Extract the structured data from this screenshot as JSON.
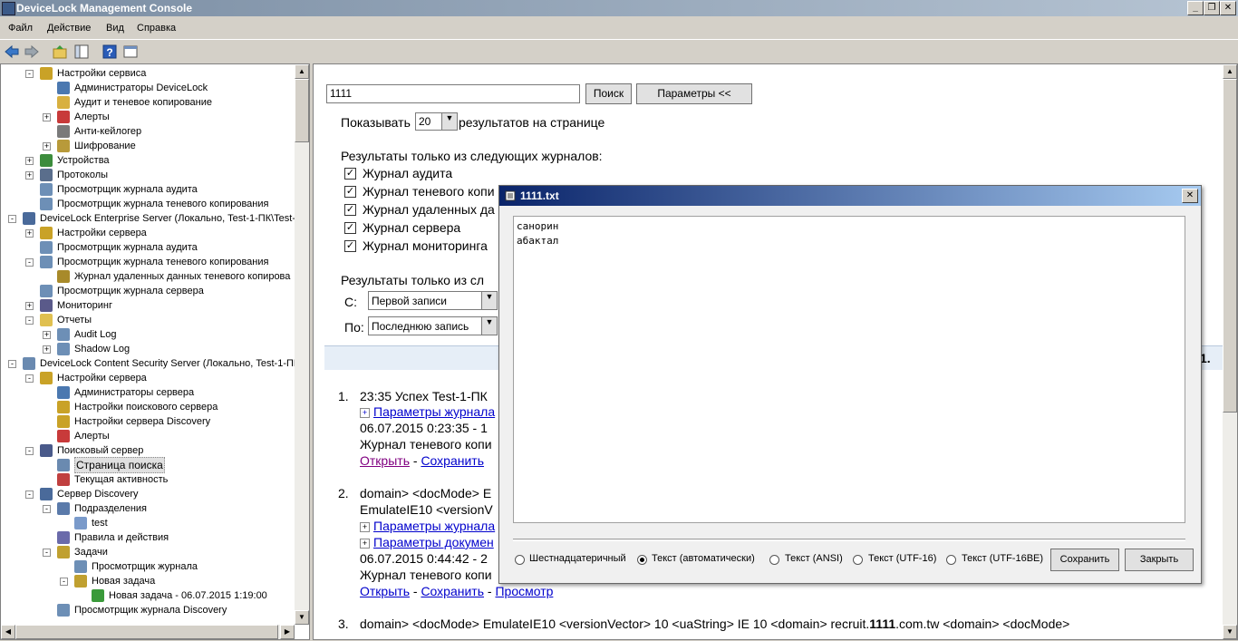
{
  "window": {
    "title": "DeviceLock Management Console"
  },
  "menu": [
    "Файл",
    "Действие",
    "Вид",
    "Справка"
  ],
  "toolbar_icons": [
    "back-arrow-icon",
    "forward-arrow-icon",
    "folder-up-icon",
    "show-tree-icon",
    "help-icon",
    "properties-icon"
  ],
  "tree": [
    {
      "label": "Настройки сервиса",
      "level": 2,
      "exp": "-",
      "icon": "gear"
    },
    {
      "label": "Администраторы DeviceLock",
      "level": 3,
      "exp": "",
      "icon": "users"
    },
    {
      "label": "Аудит и теневое копирование",
      "level": 3,
      "exp": "",
      "icon": "doc"
    },
    {
      "label": "Алерты",
      "level": 3,
      "exp": "+",
      "icon": "alert"
    },
    {
      "label": "Анти-кейлогер",
      "level": 3,
      "exp": "",
      "icon": "keyboard"
    },
    {
      "label": "Шифрование",
      "level": 3,
      "exp": "+",
      "icon": "crypt"
    },
    {
      "label": "Устройства",
      "level": 2,
      "exp": "+",
      "icon": "chip"
    },
    {
      "label": "Протоколы",
      "level": 2,
      "exp": "+",
      "icon": "proto"
    },
    {
      "label": "Просмотрщик журнала аудита",
      "level": 2,
      "exp": "",
      "icon": "log"
    },
    {
      "label": "Просмотрщик журнала теневого копирования",
      "level": 2,
      "exp": "",
      "icon": "log"
    },
    {
      "label": "DeviceLock Enterprise Server (Локально, Test-1-ПК\\Test-",
      "level": 1,
      "exp": "-",
      "icon": "server"
    },
    {
      "label": "Настройки сервера",
      "level": 2,
      "exp": "+",
      "icon": "gear"
    },
    {
      "label": "Просмотрщик журнала аудита",
      "level": 2,
      "exp": "",
      "icon": "log"
    },
    {
      "label": "Просмотрщик журнала теневого копирования",
      "level": 2,
      "exp": "-",
      "icon": "log"
    },
    {
      "label": "Журнал удаленных данных теневого копирова",
      "level": 3,
      "exp": "",
      "icon": "gearlog"
    },
    {
      "label": "Просмотрщик журнала сервера",
      "level": 2,
      "exp": "",
      "icon": "log"
    },
    {
      "label": "Мониторинг",
      "level": 2,
      "exp": "+",
      "icon": "monitor"
    },
    {
      "label": "Отчеты",
      "level": 2,
      "exp": "-",
      "icon": "folder"
    },
    {
      "label": "Audit Log",
      "level": 3,
      "exp": "+",
      "icon": "log"
    },
    {
      "label": "Shadow Log",
      "level": 3,
      "exp": "+",
      "icon": "log"
    },
    {
      "label": "DeviceLock Content Security Server (Локально, Test-1-ПК",
      "level": 1,
      "exp": "-",
      "icon": "search"
    },
    {
      "label": "Настройки сервера",
      "level": 2,
      "exp": "-",
      "icon": "gear"
    },
    {
      "label": "Администраторы сервера",
      "level": 3,
      "exp": "",
      "icon": "users"
    },
    {
      "label": "Настройки поискового сервера",
      "level": 3,
      "exp": "",
      "icon": "gear"
    },
    {
      "label": "Настройки сервера Discovery",
      "level": 3,
      "exp": "",
      "icon": "gear"
    },
    {
      "label": "Алерты",
      "level": 3,
      "exp": "",
      "icon": "alert"
    },
    {
      "label": "Поисковый сервер",
      "level": 2,
      "exp": "-",
      "icon": "searchsrv"
    },
    {
      "label": "Страница поиска",
      "level": 3,
      "exp": "",
      "icon": "search",
      "selected": true
    },
    {
      "label": "Текущая активность",
      "level": 3,
      "exp": "",
      "icon": "activity"
    },
    {
      "label": "Сервер Discovery",
      "level": 2,
      "exp": "-",
      "icon": "discovery"
    },
    {
      "label": "Подразделения",
      "level": 3,
      "exp": "-",
      "icon": "units"
    },
    {
      "label": "test",
      "level": 4,
      "exp": "",
      "icon": "unit"
    },
    {
      "label": "Правила и действия",
      "level": 3,
      "exp": "",
      "icon": "rules"
    },
    {
      "label": "Задачи",
      "level": 3,
      "exp": "-",
      "icon": "tasks"
    },
    {
      "label": "Просмотрщик журнала",
      "level": 4,
      "exp": "",
      "icon": "log"
    },
    {
      "label": "Новая задача",
      "level": 4,
      "exp": "-",
      "icon": "tasks"
    },
    {
      "label": "Новая задача - 06.07.2015 1:19:00",
      "level": 5,
      "exp": "",
      "icon": "taskrun"
    },
    {
      "label": "Просмотрщик журнала Discovery",
      "level": 3,
      "exp": "",
      "icon": "log"
    }
  ],
  "search": {
    "query": "1111",
    "search_button": "Поиск",
    "params_button": "Параметры <<",
    "show_label": "Показывать",
    "per_page": "20",
    "per_page_suffix": "результатов на странице",
    "logs_heading": "Результаты только из следующих журналов:",
    "logs": [
      "Журнал аудита",
      "Журнал теневого копи",
      "Журнал удаленных да",
      "Журнал сервера",
      "Журнал мониторинга"
    ],
    "range_heading": "Результаты только из сл",
    "from_label": "С:",
    "from_value": "Первой записи",
    "to_label": "По:",
    "to_value": "Последнюю запись"
  },
  "results": {
    "r1": {
      "num": "1.",
      "line1": "23:35 Успех Test-1-ПК",
      "link1": "Параметры журнала",
      "line2": "06.07.2015 0:23:35 - 1",
      "line3": "Журнал теневого копи",
      "open": "Открыть",
      "sep": "-",
      "save": "Сохранить"
    },
    "r2": {
      "num": "2.",
      "line1": "domain> <docMode> E",
      "line2": "EmulateIE10 <versionV",
      "link1": "Параметры журнала",
      "link2": "Параметры докумен",
      "line3": "06.07.2015 0:44:42 - 2",
      "line4": "Журнал теневого копи",
      "open": "Открыть",
      "sep1": "-",
      "save": "Сохранить",
      "sep2": "-",
      "view": "Просмотр"
    },
    "r3": {
      "num": "3.",
      "pre": "domain> <docMode> EmulateIE10 <versionVector> 10 <uaString> IE 10 <domain> recruit.",
      "bold": "1111",
      "post": ".com.tw <domain> <docMode>"
    },
    "edge_fragment": "1."
  },
  "dialog": {
    "title": "1111.txt",
    "close": "✕",
    "content": [
      "санорин",
      "абактал"
    ],
    "radios": [
      {
        "label": "Шестнадцатеричный",
        "checked": false
      },
      {
        "label": "Текст (автоматически)",
        "checked": true
      },
      {
        "label": "Текст (ANSI)",
        "checked": false
      },
      {
        "label": "Текст (UTF-16)",
        "checked": false
      },
      {
        "label": "Текст (UTF-16BE)",
        "checked": false
      }
    ],
    "save_button": "Сохранить",
    "close_button": "Закрыть"
  }
}
